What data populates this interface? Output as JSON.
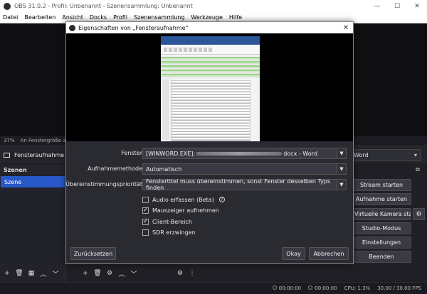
{
  "window": {
    "title": "OBS 31.0.2 - Profil: Unbenannt - Szenensammlung: Unbenannt"
  },
  "menu": [
    "Datei",
    "Bearbeiten",
    "Ansicht",
    "Docks",
    "Profil",
    "Szenensammlung",
    "Werkzeuge",
    "Hilfe"
  ],
  "status_line": {
    "zoom": "37%",
    "text": "An Fenstergröße anpa"
  },
  "source": {
    "name": "Fensteraufnahme",
    "right_select": "Word"
  },
  "scenes": {
    "header": "Szenen",
    "items": [
      "Szene"
    ]
  },
  "controls": [
    "Stream starten",
    "Aufnahme starten",
    "Virtuelle Kamera starten",
    "Studio-Modus",
    "Einstellungen",
    "Beenden"
  ],
  "statusbar": {
    "rec_time": "00:00:00",
    "stream_time": "00:00:00",
    "cpu": "CPU: 1.3%",
    "fps": "30.00 / 30.00 FPS"
  },
  "dialog": {
    "title": "Eigenschaften von „Fensteraufnahme“",
    "fields": {
      "fenster_label": "Fenster",
      "fenster_value_prefix": "[WINWORD.EXE]:",
      "fenster_value_suffix": "docx - Word",
      "methode_label": "Aufnahmemethode",
      "methode_value": "Automatisch",
      "prio_label": "Übereinstimmungspriorität",
      "prio_value": "Fenstertitel muss übereinstimmen, sonst Fenster desselben Typs finden"
    },
    "checks": [
      {
        "label": "Audio erfassen (Beta)",
        "checked": false
      },
      {
        "label": "Mauszeiger aufnehmen",
        "checked": true
      },
      {
        "label": "Client-Bereich",
        "checked": true
      },
      {
        "label": "SDR erzwingen",
        "checked": false
      }
    ],
    "buttons": {
      "reset": "Zurücksetzen",
      "ok": "Okay",
      "cancel": "Abbrechen"
    }
  }
}
